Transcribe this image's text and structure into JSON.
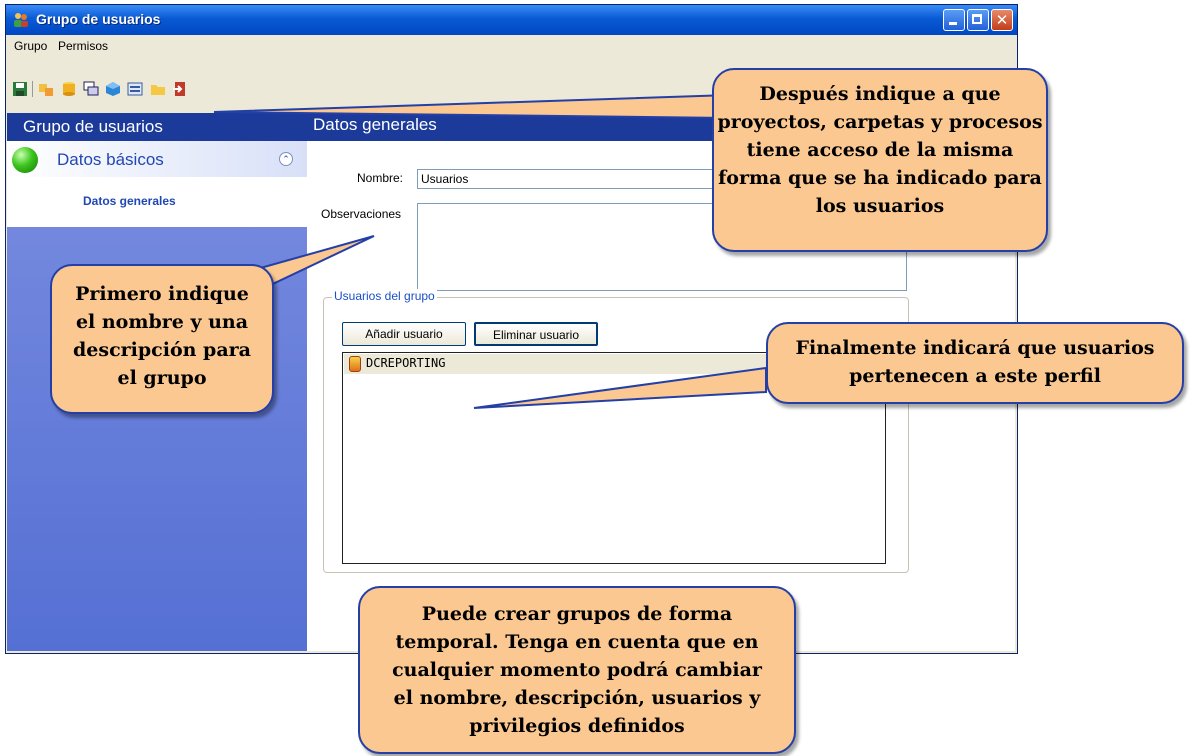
{
  "window": {
    "title": "Grupo de usuarios",
    "menu": [
      "Grupo",
      "Permisos"
    ],
    "toolbar_icons": [
      "save-icon",
      "users-icon",
      "database-icon",
      "windows-icon",
      "cube-icon",
      "form-icon",
      "folder-icon",
      "exit-icon"
    ]
  },
  "sidebar": {
    "header": "Grupo de usuarios",
    "section_title": "Datos básicos",
    "items": [
      "Datos generales"
    ]
  },
  "content": {
    "header": "Datos generales",
    "nombre_label": "Nombre:",
    "nombre_value": "Usuarios",
    "observaciones_label": "Observaciones",
    "observaciones_value": "",
    "group_title": "Usuarios del grupo",
    "add_button": "Añadir usuario",
    "remove_button": "Eliminar usuario",
    "users": [
      "DCREPORTING"
    ]
  },
  "callouts": {
    "top_right": "Después indique a que proyectos, carpetas y procesos tiene acceso de la misma forma que se ha indicado para los usuarios",
    "left": "Primero indique el nombre y una descripción para el grupo",
    "middle_right": "Finalmente indicará que usuarios pertenecen a este perfil",
    "bottom": "Puede crear grupos de forma temporal. Tenga en cuenta que en cualquier momento podrá cambiar el nombre, descripción, usuarios y privilegios definidos"
  },
  "colors": {
    "titlebar": "#0a5ad4",
    "panel_header": "#1b3a99",
    "sidebar": "#6a80da",
    "callout_fill": "#fac890",
    "callout_border": "#243fa6"
  }
}
